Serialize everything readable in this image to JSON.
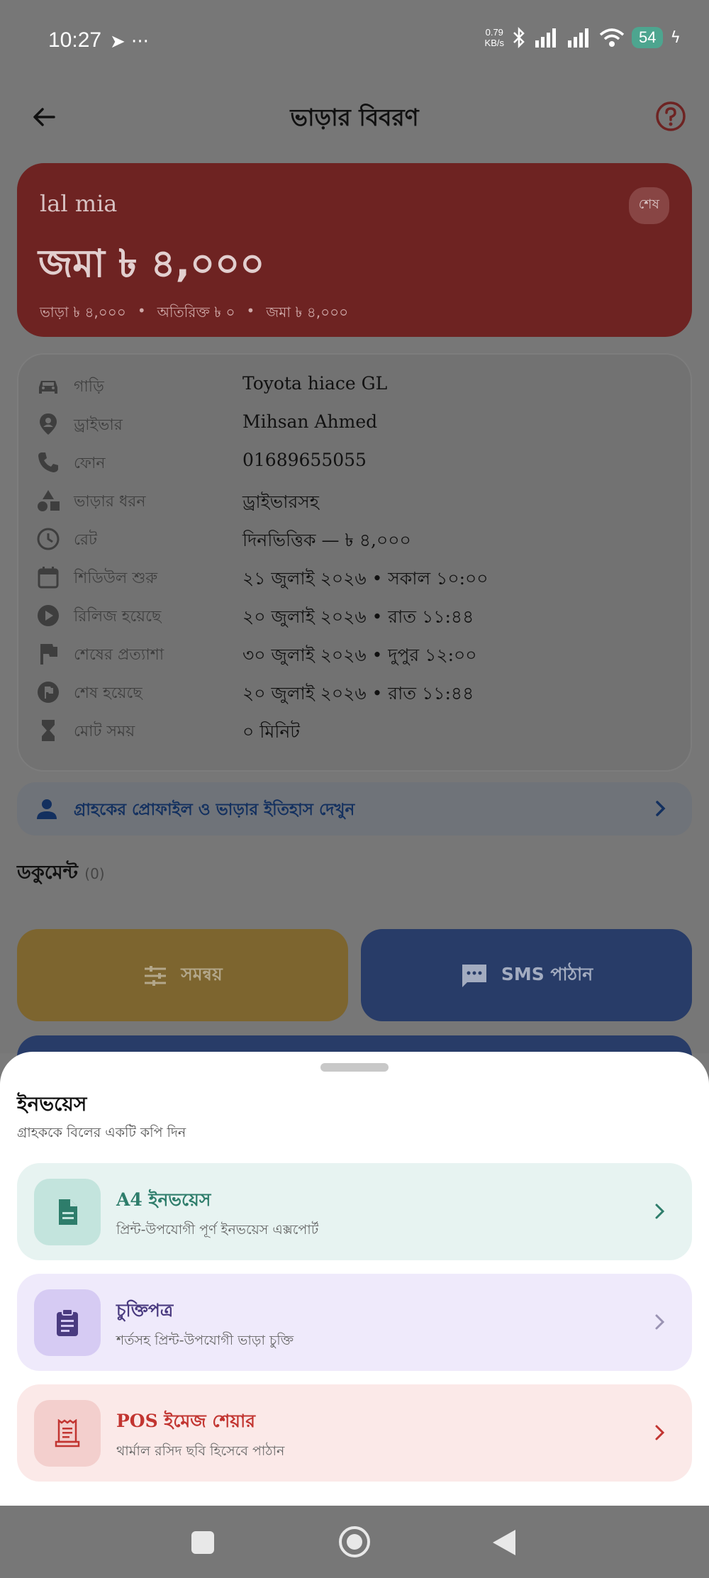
{
  "status_bar": {
    "time": "10:27",
    "speed_value": "0.79",
    "speed_unit": "KB/s",
    "battery": "54"
  },
  "app_bar": {
    "title": "ভাড়ার বিবরণ"
  },
  "summary": {
    "customer_name": "lal mia",
    "status_badge": "শেষ",
    "amount": "জমা ৳ ৪,০০০",
    "rent": "ভাড়া ৳ ৪,০০০",
    "extra": "অতিরিক্ত ৳ ০",
    "deposit": "জমা ৳ ৪,০০০",
    "separator": "•"
  },
  "details": [
    {
      "icon": "car-icon",
      "label": "গাড়ি",
      "value": "Toyota hiace GL"
    },
    {
      "icon": "driver-pin-icon",
      "label": "ড্রাইভার",
      "value": "Mihsan Ahmed"
    },
    {
      "icon": "phone-icon",
      "label": "ফোন",
      "value": "01689655055"
    },
    {
      "icon": "shapes-icon",
      "label": "ভাড়ার ধরন",
      "value": "ড্রাইভারসহ"
    },
    {
      "icon": "clock-icon",
      "label": "রেট",
      "value": "দিনভিত্তিক — ৳ ৪,০০০"
    },
    {
      "icon": "calendar-icon",
      "label": "শিডিউল শুরু",
      "value": "২১ জুলাই ২০২৬ • সকাল ১০:০০"
    },
    {
      "icon": "play-circle-icon",
      "label": "রিলিজ হয়েছে",
      "value": "২০ জুলাই ২০২৬ • রাত ১১:৪৪"
    },
    {
      "icon": "flag-icon",
      "label": "শেষের প্রত্যাশা",
      "value": "৩০ জুলাই ২০২৬ • দুপুর ১২:০০"
    },
    {
      "icon": "flag-circle-icon",
      "label": "শেষ হয়েছে",
      "value": "২০ জুলাই ২০২৬ • রাত ১১:৪৪"
    },
    {
      "icon": "hourglass-icon",
      "label": "মোট সময়",
      "value": "০ মিনিট"
    }
  ],
  "customer_link": {
    "label": "গ্রাহকের প্রোফাইল ও ভাড়ার ইতিহাস দেখুন"
  },
  "documents": {
    "title": "ডকুমেন্ট",
    "count": "(0)"
  },
  "actions": {
    "sync_label": "সমন্বয়",
    "sms_label": "SMS পাঠান"
  },
  "sheet": {
    "title": "ইনভয়েস",
    "subtitle": "গ্রাহককে বিলের একটি কপি দিন",
    "options": [
      {
        "title": "A4 ইনভয়েস",
        "desc": "প্রিন্ট-উপযোগী পূর্ণ ইনভয়েস এক্সপোর্ট",
        "icon": "document-icon"
      },
      {
        "title": "চুক্তিপত্র",
        "desc": "শর্তসহ প্রিন্ট-উপযোগী ভাড়া চুক্তি",
        "icon": "clipboard-icon"
      },
      {
        "title": "POS ইমেজ শেয়ার",
        "desc": "থার্মাল রসিদ ছবি হিসেবে পাঠান",
        "icon": "receipt-icon"
      }
    ]
  },
  "colors": {
    "a4_accent": "#2e7d6b",
    "contract_accent": "#4a3b80",
    "pos_accent": "#c23531"
  }
}
